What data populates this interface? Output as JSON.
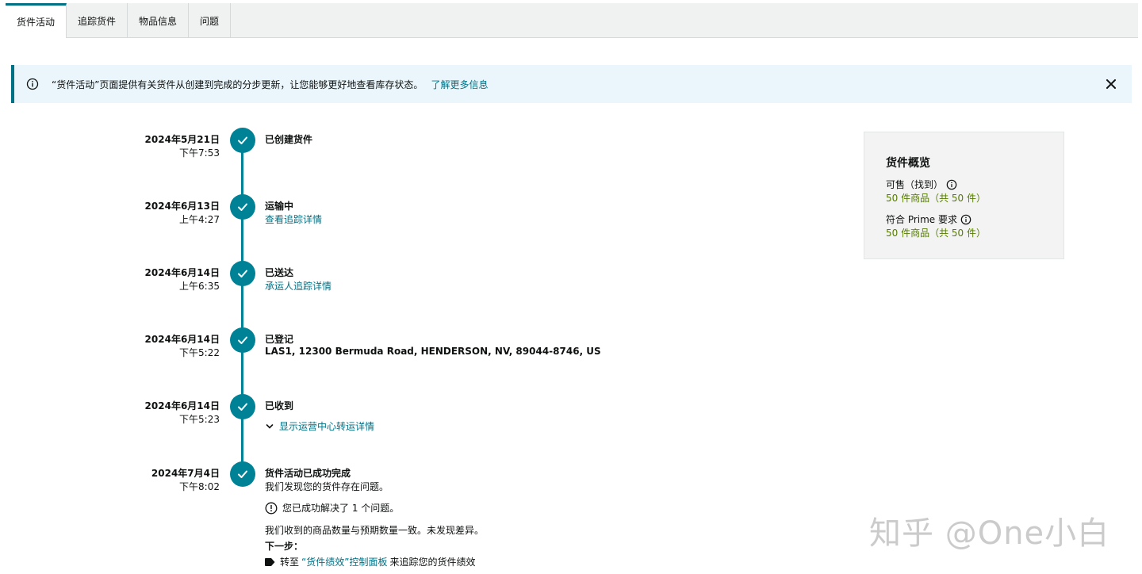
{
  "tabs": [
    {
      "label": "货件活动"
    },
    {
      "label": "追踪货件"
    },
    {
      "label": "物品信息"
    },
    {
      "label": "问题"
    }
  ],
  "alert": {
    "message": "“货件活动”页面提供有关货件从创建到完成的分步更新，让您能够更好地查看库存状态。",
    "link": "了解更多信息"
  },
  "timeline": [
    {
      "date": "2024年5月21日",
      "time": "下午7:53",
      "title": "已创建货件",
      "sub": ""
    },
    {
      "date": "2024年6月13日",
      "time": "上午4:27",
      "title": "运输中",
      "sub": "查看追踪详情"
    },
    {
      "date": "2024年6月14日",
      "time": "上午6:35",
      "title": "已送达",
      "sub": "承运人追踪详情"
    },
    {
      "date": "2024年6月14日",
      "time": "下午5:22",
      "title": "已登记",
      "sub": "LAS1, 12300 Bermuda Road, HENDERSON, NV, 89044-8746, US"
    },
    {
      "date": "2024年6月14日",
      "time": "下午5:23",
      "title": "已收到",
      "sub": ""
    },
    {
      "date": "2024年7月4日",
      "time": "下午8:02",
      "title": "货件活动已成功完成",
      "sub": "我们发现您的货件存在问题。"
    }
  ],
  "received_toggle": "显示运营中心转运详情",
  "completion": {
    "resolved": "您已成功解决了 1 个问题。",
    "match_note": "我们收到的商品数量与预期数量一致。未发现差异。",
    "next_step_label": "下一步：",
    "next_prefix": "转至",
    "next_link": "“货件绩效”控制面板",
    "next_suffix": "来追踪您的货件绩效"
  },
  "summary": {
    "title": "货件概览",
    "sellable_label": "可售（找到）",
    "sellable_value": "50 件商品（共 50 件）",
    "prime_label": "符合 Prime 要求",
    "prime_value": "50 件商品（共 50 件）"
  },
  "watermark": "知乎 @One小白",
  "colors": {
    "accent": "#007185",
    "timeline": "#008296",
    "success_text": "#567b00",
    "alert_bg": "#eaf6fb"
  },
  "icons": {
    "info": "info-icon",
    "close": "close-icon",
    "check": "check-icon",
    "chevron": "chevron-down-icon",
    "alert": "alert-circle-icon",
    "tag": "tag-icon"
  }
}
